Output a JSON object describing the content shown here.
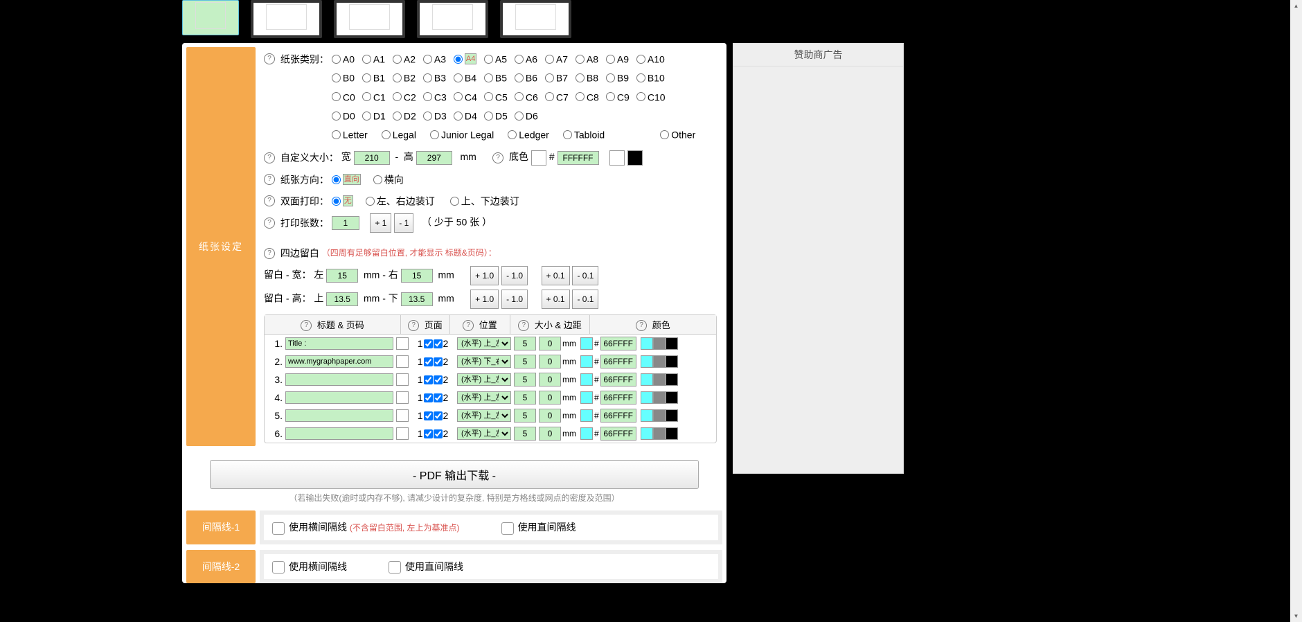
{
  "sidebar_title": "纸张设定",
  "paper_type": {
    "label": "纸张类别：",
    "rows": [
      [
        "A0",
        "A1",
        "A2",
        "A3",
        "A4",
        "A5",
        "A6",
        "A7",
        "A8",
        "A9",
        "A10"
      ],
      [
        "B0",
        "B1",
        "B2",
        "B3",
        "B4",
        "B5",
        "B6",
        "B7",
        "B8",
        "B9",
        "B10"
      ],
      [
        "C0",
        "C1",
        "C2",
        "C3",
        "C4",
        "C5",
        "C6",
        "C7",
        "C8",
        "C9",
        "C10"
      ],
      [
        "D0",
        "D1",
        "D2",
        "D3",
        "D4",
        "D5",
        "D6"
      ],
      [
        "Letter",
        "Legal",
        "Junior Legal",
        "Ledger",
        "Tabloid"
      ]
    ],
    "other": "Other",
    "selected": "A4"
  },
  "custom_size": {
    "label": "自定义大小：",
    "w_label": "宽",
    "w": "210",
    "h_label": "高",
    "h": "297",
    "unit": "mm",
    "bg_label": "底色",
    "hash": "#",
    "bg_hex": "FFFFFF"
  },
  "orientation": {
    "label": "纸张方向：",
    "opts": [
      "直向",
      "横向"
    ],
    "selected": "直向"
  },
  "duplex": {
    "label": "双面打印：",
    "opts": [
      "无",
      "左、右边装订",
      "上、下边装订"
    ],
    "selected": "无"
  },
  "copies": {
    "label": "打印张数：",
    "value": "1",
    "plus": "+ 1",
    "minus": "- 1",
    "note": "（ 少于 50 张 ）"
  },
  "margins": {
    "label": "四边留白",
    "note": "（四周有足够留白位置, 才能显示 标题&页码）：",
    "row_w": {
      "label": "留白 - 宽：",
      "l_label": "左",
      "l": "15",
      "r_label": "右",
      "r": "15",
      "unit": "mm"
    },
    "row_h": {
      "label": "留白 - 高：",
      "t_label": "上",
      "t": "13.5",
      "b_label": "下",
      "b": "13.5",
      "unit": "mm"
    },
    "btns": [
      "+ 1.0",
      "- 1.0",
      "+ 0.1",
      "- 0.1"
    ]
  },
  "titles": {
    "headers": [
      "标题 & 页码",
      "页面",
      "位置",
      "大小 & 边距",
      "颜色"
    ],
    "rows": [
      {
        "n": "1.",
        "text": "Title :",
        "p1": true,
        "p2": true,
        "pos": "(水平) 上_左",
        "sz": "5",
        "mg": "0",
        "unit": "mm",
        "hex": "66FFFF"
      },
      {
        "n": "2.",
        "text": "www.mygraphpaper.com",
        "p1": true,
        "p2": true,
        "pos": "(水平) 下_右",
        "sz": "5",
        "mg": "0",
        "unit": "mm",
        "hex": "66FFFF"
      },
      {
        "n": "3.",
        "text": "",
        "p1": true,
        "p2": true,
        "pos": "(水平) 上_左",
        "sz": "5",
        "mg": "0",
        "unit": "mm",
        "hex": "66FFFF"
      },
      {
        "n": "4.",
        "text": "",
        "p1": true,
        "p2": true,
        "pos": "(水平) 上_左",
        "sz": "5",
        "mg": "0",
        "unit": "mm",
        "hex": "66FFFF"
      },
      {
        "n": "5.",
        "text": "",
        "p1": true,
        "p2": true,
        "pos": "(水平) 上_左",
        "sz": "5",
        "mg": "0",
        "unit": "mm",
        "hex": "66FFFF"
      },
      {
        "n": "6.",
        "text": "",
        "p1": true,
        "p2": true,
        "pos": "(水平) 上_左",
        "sz": "5",
        "mg": "0",
        "unit": "mm",
        "hex": "66FFFF"
      }
    ]
  },
  "download": {
    "label": "- PDF 输出下载 -",
    "note": "（若输出失败(逾时或内存不够), 请减少设计的复杂度, 特别是方格线或网点的密度及范围）"
  },
  "dividers": [
    {
      "label": "间隔线-1",
      "h_label": "使用横间隔线",
      "h_note": "(不含留白范围, 左上为基准点)",
      "v_label": "使用直间隔线"
    },
    {
      "label": "间隔线-2",
      "h_label": "使用横间隔线",
      "h_note": "",
      "v_label": "使用直间隔线"
    }
  ],
  "ad_title": "赞助商广告",
  "colors": {
    "accent_cyan": "#66FFFF",
    "gray": "#888",
    "black": "#000",
    "white": "#fff"
  }
}
